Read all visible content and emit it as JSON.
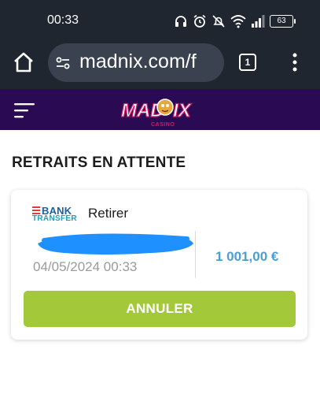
{
  "status_bar": {
    "time": "00:33",
    "battery": "63"
  },
  "browser": {
    "url": "madnix.com/f",
    "tab_count": "1"
  },
  "site": {
    "logo_text": "MADNIX",
    "logo_subtext": "CASINO"
  },
  "page": {
    "section_title": "RETRAITS EN ATTENTE"
  },
  "withdrawal": {
    "method_logo_top": "BANK",
    "method_logo_bottom": "TRANSFER",
    "label": "Retirer",
    "datetime": "04/05/2024 00:33",
    "amount": "1 001,00 €",
    "cancel_label": "ANNULER"
  },
  "colors": {
    "chrome_bg": "#1f2630",
    "header_bg": "#2a0a52",
    "amount": "#4a9ed6",
    "button": "#a3c93a",
    "redaction": "#1e90ff"
  }
}
